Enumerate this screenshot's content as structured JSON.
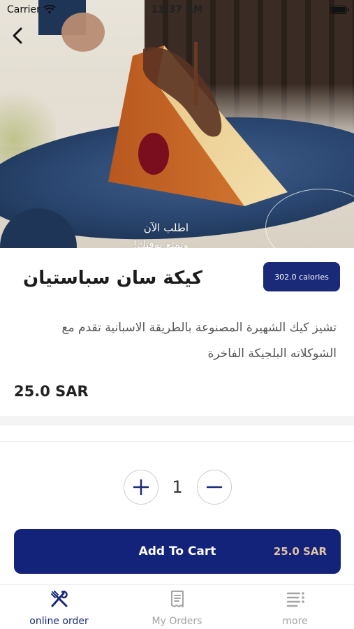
{
  "status_bar": {
    "carrier": "Carrier",
    "time": "11:37 AM"
  },
  "hero": {
    "slogan_line1": "اطلب الآن",
    "slogan_line2": "وتمتع بوقتك!"
  },
  "product": {
    "title": "كيكة سان سباستيان",
    "calories": "302.0 calories",
    "description": "تشيز كيك الشهيرة المصنوعة بالطريقة الاسبانية تقدم مع الشوكلاته البلجيكة الفاخرة",
    "price": "25.0 SAR"
  },
  "quantity": {
    "value": "1"
  },
  "add_to_cart": {
    "label": "Add To Cart",
    "price": "25.0 SAR"
  },
  "tab_bar": {
    "tabs": [
      {
        "label": "online order",
        "icon": "utensils-icon",
        "active": true
      },
      {
        "label": "My Orders",
        "icon": "receipt-icon",
        "active": false
      },
      {
        "label": "more",
        "icon": "menu-icon",
        "active": false
      }
    ]
  },
  "colors": {
    "primary": "#13237a",
    "badge": "#1a2a78",
    "accent_price": "#e1c3a5",
    "inactive_tab": "#a5a5a5"
  }
}
